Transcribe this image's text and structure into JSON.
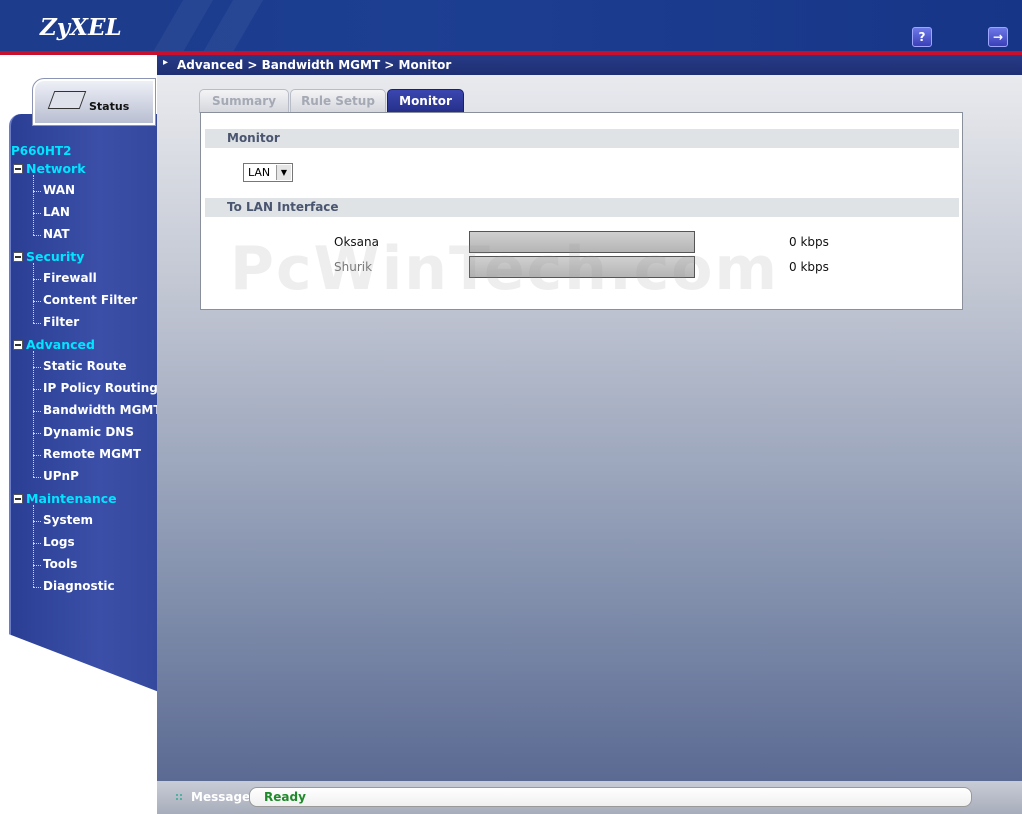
{
  "header": {
    "logo": "ZyXEL",
    "help_icon": "question-mark-icon",
    "logout_icon": "logout-icon"
  },
  "sidebar": {
    "status_label": "Status",
    "model": "P660HT2",
    "sections": [
      {
        "label": "Network",
        "items": [
          "WAN",
          "LAN",
          "NAT"
        ]
      },
      {
        "label": "Security",
        "items": [
          "Firewall",
          "Content Filter",
          "Filter"
        ]
      },
      {
        "label": "Advanced",
        "items": [
          "Static Route",
          "IP Policy Routing",
          "Bandwidth MGMT",
          "Dynamic DNS",
          "Remote MGMT",
          "UPnP"
        ]
      },
      {
        "label": "Maintenance",
        "items": [
          "System",
          "Logs",
          "Tools",
          "Diagnostic"
        ]
      }
    ]
  },
  "breadcrumb": "Advanced > Bandwidth MGMT > Monitor",
  "tabs": [
    {
      "label": "Summary",
      "active": false
    },
    {
      "label": "Rule Setup",
      "active": false
    },
    {
      "label": "Monitor",
      "active": true
    }
  ],
  "monitor": {
    "section_title": "Monitor",
    "interface_select": "LAN",
    "interface_section_title": "To LAN Interface",
    "rows": [
      {
        "name": "Oksana",
        "rate": "0 kbps",
        "usage_fraction": 0
      },
      {
        "name": "Shurik",
        "rate": "0 kbps",
        "usage_fraction": 0
      }
    ]
  },
  "watermark": "PcWinTech.com",
  "footer": {
    "message_label": "Message",
    "message_text": "Ready"
  },
  "colors": {
    "header_blue": "#1d3c8c",
    "accent_red": "#c8102e",
    "nav_section": "#00e5ff",
    "ready_green": "#1f8a2a"
  }
}
